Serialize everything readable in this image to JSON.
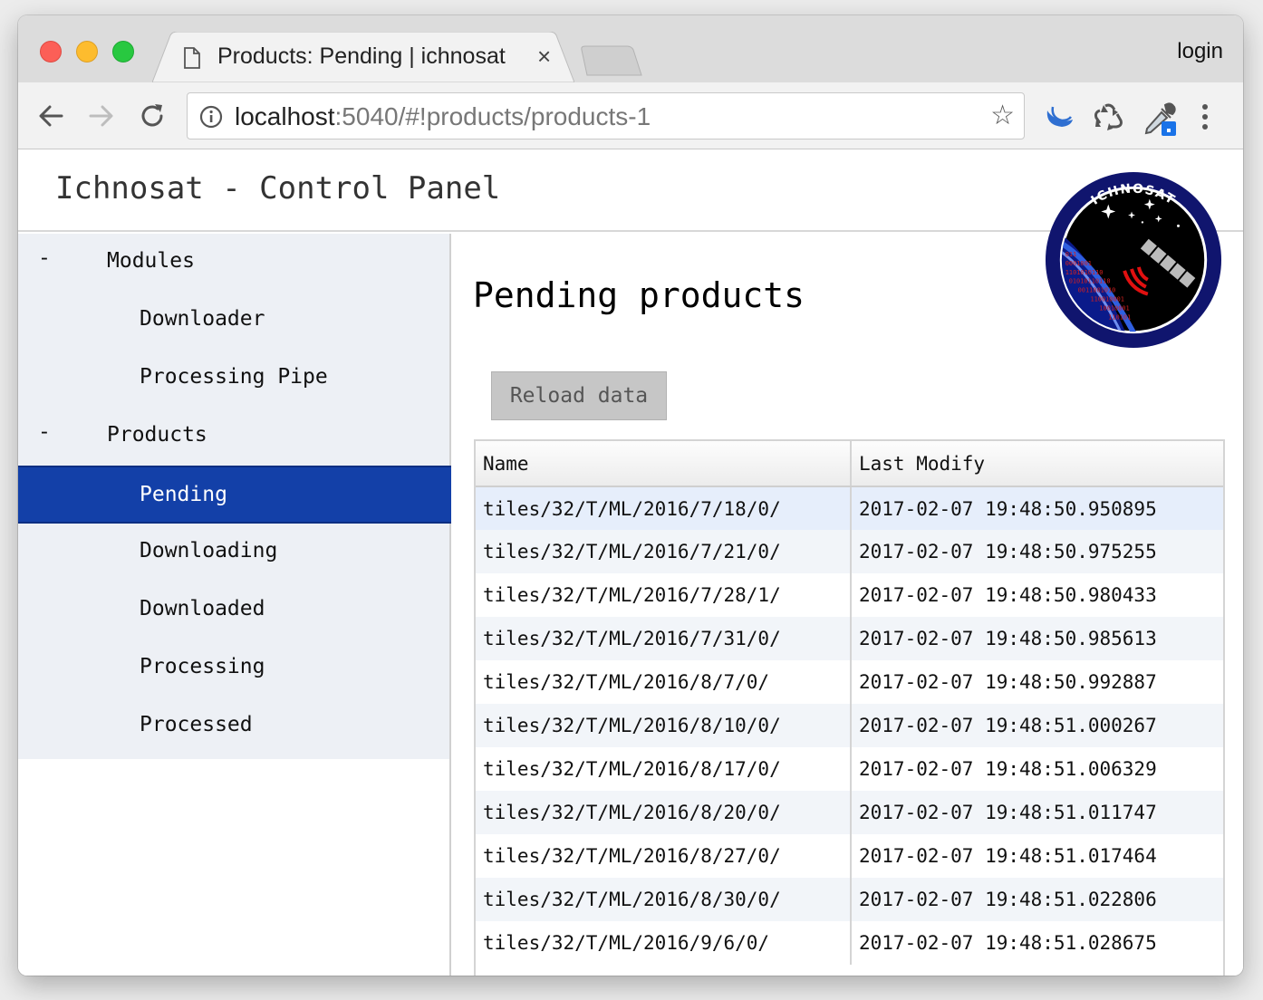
{
  "browser": {
    "tab_title": "Products: Pending | ichnosat",
    "tab_close": "×",
    "login_label": "login",
    "url_host": "localhost",
    "url_rest": ":5040/#!products/products-1",
    "star_glyph": "☆",
    "icons": [
      "back-arrow-icon",
      "forward-arrow-icon",
      "reload-icon",
      "info-icon",
      "star-icon",
      "moon-extension-icon",
      "recycle-extension-icon",
      "eyedropper-extension-icon",
      "menu-dots-icon"
    ]
  },
  "app": {
    "title": "Ichnosat - Control Panel",
    "logo": {
      "ring_text": "ICHNOSAT",
      "binary": [
        "011",
        "0001001",
        "1101010110",
        "01010110110",
        "0011001010",
        "110010001",
        "10010001",
        "110101"
      ]
    }
  },
  "sidebar": {
    "groups": [
      {
        "toggle": "-",
        "label": "Modules",
        "items": [
          {
            "label": "Downloader"
          },
          {
            "label": "Processing Pipe"
          }
        ]
      },
      {
        "toggle": "-",
        "label": "Products",
        "items": [
          {
            "label": "Pending",
            "active": true
          },
          {
            "label": "Downloading"
          },
          {
            "label": "Downloaded"
          },
          {
            "label": "Processing"
          },
          {
            "label": "Processed"
          }
        ]
      }
    ]
  },
  "main": {
    "heading": "Pending products",
    "reload_label": "Reload data",
    "table": {
      "headers": [
        "Name",
        "Last Modify"
      ],
      "rows": [
        [
          "tiles/32/T/ML/2016/7/18/0/",
          "2017-02-07 19:48:50.950895"
        ],
        [
          "tiles/32/T/ML/2016/7/21/0/",
          "2017-02-07 19:48:50.975255"
        ],
        [
          "tiles/32/T/ML/2016/7/28/1/",
          "2017-02-07 19:48:50.980433"
        ],
        [
          "tiles/32/T/ML/2016/7/31/0/",
          "2017-02-07 19:48:50.985613"
        ],
        [
          "tiles/32/T/ML/2016/8/7/0/",
          "2017-02-07 19:48:50.992887"
        ],
        [
          "tiles/32/T/ML/2016/8/10/0/",
          "2017-02-07 19:48:51.000267"
        ],
        [
          "tiles/32/T/ML/2016/8/17/0/",
          "2017-02-07 19:48:51.006329"
        ],
        [
          "tiles/32/T/ML/2016/8/20/0/",
          "2017-02-07 19:48:51.011747"
        ],
        [
          "tiles/32/T/ML/2016/8/27/0/",
          "2017-02-07 19:48:51.017464"
        ],
        [
          "tiles/32/T/ML/2016/8/30/0/",
          "2017-02-07 19:48:51.022806"
        ],
        [
          "tiles/32/T/ML/2016/9/6/0/",
          "2017-02-07 19:48:51.028675"
        ]
      ]
    }
  },
  "colors": {
    "sidebar_bg": "#edf0f5",
    "active_item": "#1340a8",
    "logo_ring": "#10156e"
  }
}
